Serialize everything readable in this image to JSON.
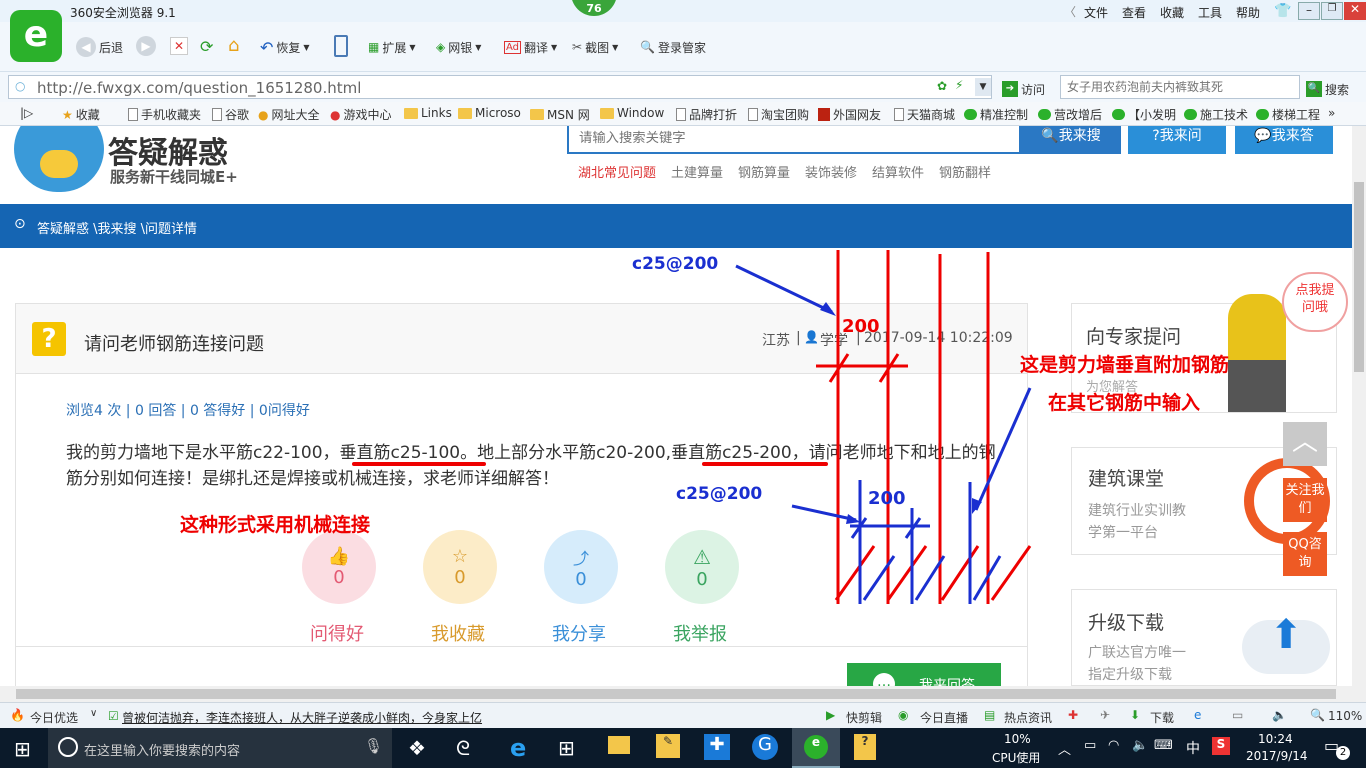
{
  "window": {
    "title": "360安全浏览器 9.1",
    "badge": "76",
    "menu": [
      "文件",
      "查看",
      "收藏",
      "工具",
      "帮助"
    ]
  },
  "toolbar": {
    "back": "后退",
    "restore": "恢复",
    "extend": "扩展",
    "bank": "网银",
    "translate": "翻译",
    "screenshot": "截图",
    "login": "登录管家"
  },
  "address": {
    "url": "http://e.fwxgx.com/question_1651280.html",
    "visit": "访问",
    "search_placeholder": "女子用农药泡前夫内裤致其死",
    "search_btn": "搜索"
  },
  "favorites": [
    "收藏",
    "手机收藏夹",
    "谷歌",
    "网址大全",
    "游戏中心",
    "Links",
    "Microso",
    "MSN 网",
    "Window",
    "品牌打折",
    "淘宝团购",
    "外国网友",
    "天猫商城",
    "精准控制",
    "营改增后",
    "【小发明",
    "施工技术",
    "楼梯工程"
  ],
  "site": {
    "logo": "答疑解惑",
    "slogan": "服务新干线同城E+",
    "search_placeholder": "请输入搜索关键字",
    "btn_search": "我来搜",
    "btn_ask": "我来问",
    "btn_answer": "我来答",
    "nav": [
      "湖北常见问题",
      "土建算量",
      "钢筋算量",
      "装饰装修",
      "结算软件",
      "钢筋翻样"
    ],
    "breadcrumb": "答疑解惑 \\我来搜 \\问题详情"
  },
  "question": {
    "title": "请问老师钢筋连接问题",
    "location": "江苏",
    "user": "学学",
    "time": "2017-09-14 10:22:09",
    "stats": "浏览4 次 | 0 回答 | 0 答得好 | 0问得好",
    "body": "我的剪力墙地下是水平筋c22-100，垂直筋c25-100。地上部分水平筋c20-200,垂直筋c25-200，请问老师地下和地上的钢筋分别如何连接！是绑扎还是焊接或机械连接，求老师详细解答！",
    "actions": [
      {
        "label": "问得好",
        "count": "0"
      },
      {
        "label": "我收藏",
        "count": "0"
      },
      {
        "label": "我分享",
        "count": "0"
      },
      {
        "label": "我举报",
        "count": "0"
      }
    ],
    "answer_btn": "我来回答"
  },
  "sidebar": {
    "expert_title": "向专家提问",
    "expert_sub": "为您解答",
    "bubble": "点我提问哦",
    "class_title": "建筑课堂",
    "class_sub1": "建筑行业实训教",
    "class_sub2": "学第一平台",
    "upgrade_title": "升级下载",
    "upgrade_sub1": "广联达官方唯一",
    "upgrade_sub2": "指定升级下载",
    "follow": "关注我们",
    "qq": "QQ咨询"
  },
  "annotations": {
    "top_label": "c25@200",
    "top_dim": "200",
    "right_note1": "这是剪力墙垂直附加钢筋",
    "right_note2": "在其它钢筋中输入",
    "mid_label": "c25@200",
    "mid_dim": "200",
    "left_note": "这种形式采用机械连接"
  },
  "statusbar": {
    "today": "今日优选",
    "news": "曾被何洁抛弃，李连杰接班人，从大胖子逆袭成小鲜肉，今身家上亿",
    "quickclip": "快剪辑",
    "live": "今日直播",
    "hot": "热点资讯",
    "download": "下载",
    "zoom": "110%"
  },
  "taskbar": {
    "search": "在这里输入你要搜索的内容",
    "cpu": "10%",
    "cpu_label": "CPU使用",
    "ime": "中",
    "time": "10:24",
    "date": "2017/9/14",
    "notify": "2"
  }
}
